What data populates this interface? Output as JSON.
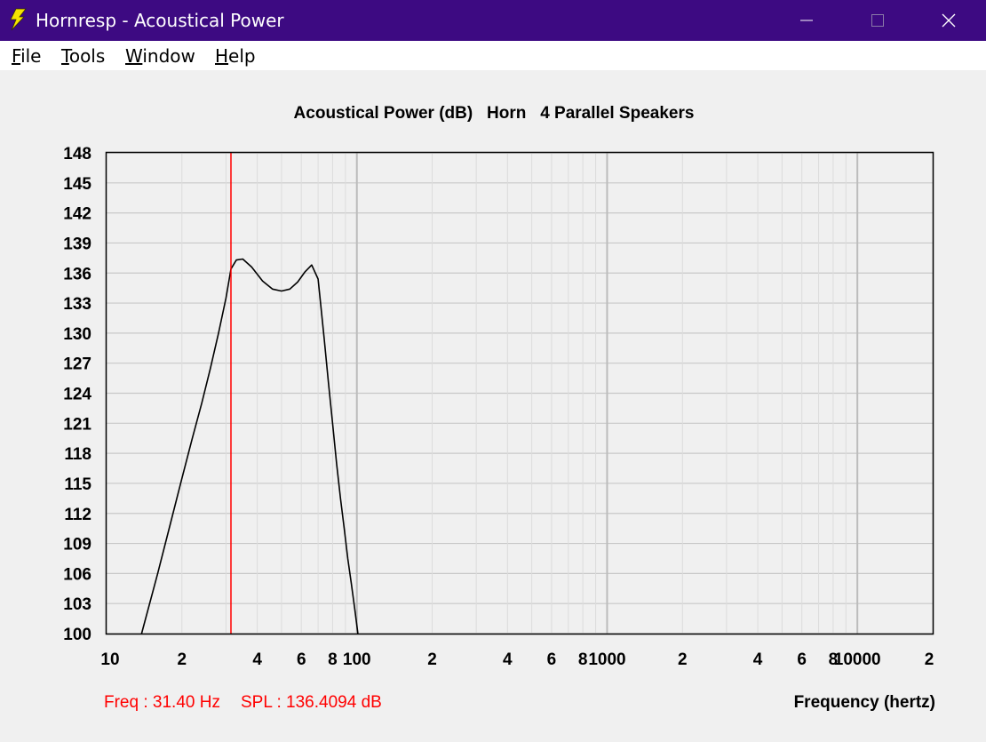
{
  "window": {
    "title": "Hornresp - Acoustical Power",
    "titlebar_color": "#3d0a82",
    "icon": "lightning-bolt-icon",
    "controls": {
      "minimize": "minimize-icon",
      "maximize": "maximize-icon",
      "close": "close-icon"
    }
  },
  "menu": [
    {
      "label": "File",
      "accel": "F",
      "rest": "ile"
    },
    {
      "label": "Tools",
      "accel": "T",
      "rest": "ools"
    },
    {
      "label": "Window",
      "accel": "W",
      "rest": "indow"
    },
    {
      "label": "Help",
      "accel": "H",
      "rest": "elp"
    }
  ],
  "readout": {
    "freq": "Freq : 31.40 Hz",
    "spl": "SPL : 136.4094 dB"
  },
  "chart_data": {
    "type": "line",
    "title": "Acoustical Power (dB)   Horn   4 Parallel Speakers",
    "xlabel": "Frequency (hertz)",
    "ylabel": "",
    "x_scale": "log",
    "xlim": [
      10,
      20000
    ],
    "ylim": [
      100,
      148
    ],
    "y_ticks": [
      148,
      145,
      142,
      139,
      136,
      133,
      130,
      127,
      124,
      121,
      118,
      115,
      112,
      109,
      106,
      103,
      100
    ],
    "x_tick_labels": [
      {
        "value": 10,
        "label": "10"
      },
      {
        "value": 20,
        "label": "2"
      },
      {
        "value": 40,
        "label": "4"
      },
      {
        "value": 60,
        "label": "6"
      },
      {
        "value": 80,
        "label": "8"
      },
      {
        "value": 100,
        "label": "100"
      },
      {
        "value": 200,
        "label": "2"
      },
      {
        "value": 400,
        "label": "4"
      },
      {
        "value": 600,
        "label": "6"
      },
      {
        "value": 800,
        "label": "8"
      },
      {
        "value": 1000,
        "label": "1000"
      },
      {
        "value": 2000,
        "label": "2"
      },
      {
        "value": 4000,
        "label": "4"
      },
      {
        "value": 6000,
        "label": "6"
      },
      {
        "value": 8000,
        "label": "8"
      },
      {
        "value": 10000,
        "label": "10000"
      },
      {
        "value": 20000,
        "label": "2"
      }
    ],
    "grid": true,
    "marker": {
      "x": 31.4,
      "color": "#ff0000"
    },
    "series": [
      {
        "color": "#000000",
        "x": [
          13.8,
          16,
          18,
          20,
          22,
          24,
          26,
          28,
          30,
          31.4,
          33,
          35,
          38,
          42,
          46,
          50,
          54,
          58,
          62,
          66,
          70,
          74,
          77,
          80,
          83,
          86,
          89,
          92,
          95,
          98,
          101
        ],
        "y": [
          100,
          106,
          111,
          115.5,
          119.5,
          123,
          126.5,
          130,
          133.5,
          136.4,
          137.3,
          137.4,
          136.6,
          135.2,
          134.4,
          134.2,
          134.4,
          135.1,
          136.1,
          136.8,
          135.4,
          129.5,
          125,
          121,
          117,
          113.5,
          110.5,
          107.5,
          105,
          102.5,
          100
        ]
      }
    ]
  }
}
